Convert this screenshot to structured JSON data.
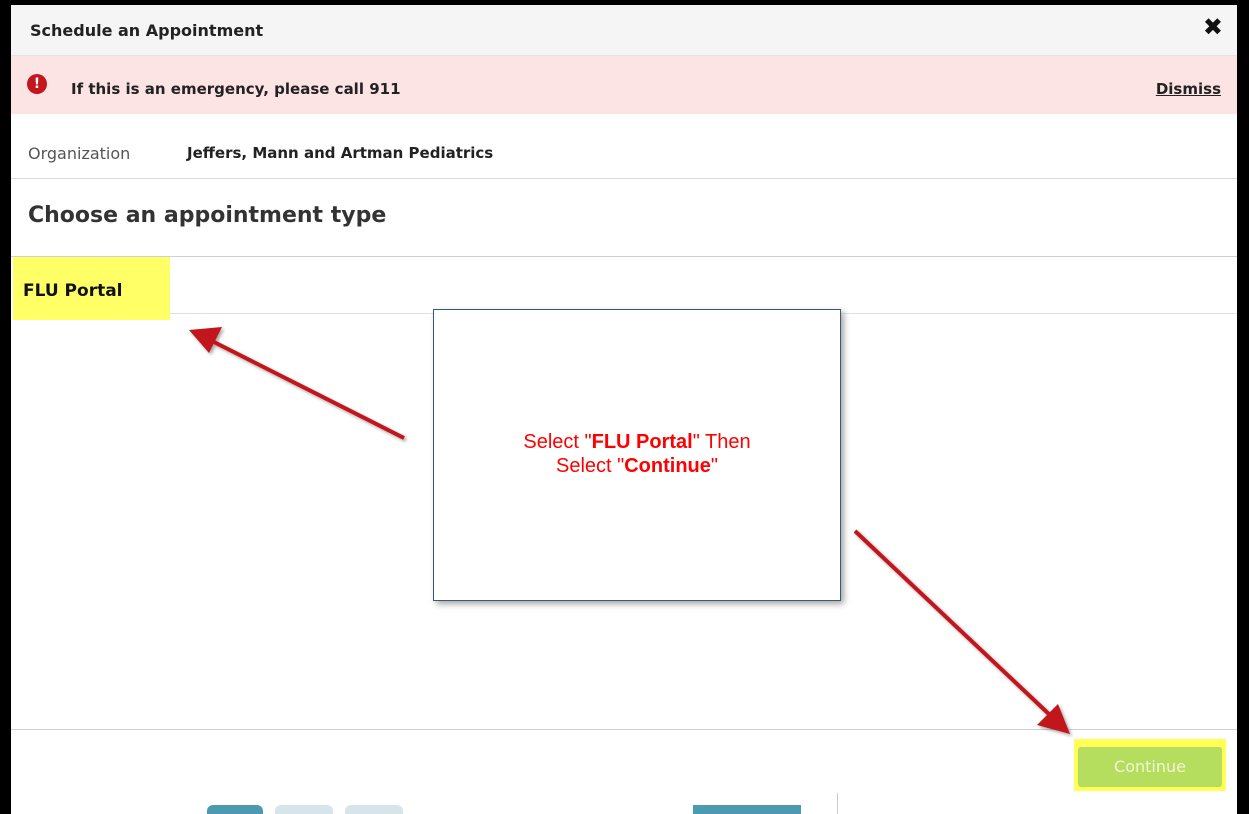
{
  "modal": {
    "title": "Schedule an Appointment",
    "close_glyph": "✖"
  },
  "alert": {
    "icon_glyph": "!",
    "message": "If this is an emergency, please call 911",
    "dismiss_label": "Dismiss",
    "background_color": "#fce4e4",
    "icon_color": "#c4161c"
  },
  "organization": {
    "label": "Organization",
    "value": "Jeffers, Mann and Artman Pediatrics"
  },
  "section": {
    "title": "Choose an appointment type"
  },
  "appointment_types": [
    {
      "label": "FLU Portal",
      "highlighted": true
    }
  ],
  "callout": {
    "part1": "Select \"",
    "bold1": "FLU Portal",
    "part2": "\" Then",
    "part3": "Select \"",
    "bold2": "Continue",
    "part4": "\"",
    "text_color": "#ff0000"
  },
  "footer": {
    "continue_label": "Continue",
    "continue_color": "#b5dd5e",
    "highlight_color": "#ffff55"
  },
  "annotation": {
    "arrow_color": "#c0161c"
  }
}
